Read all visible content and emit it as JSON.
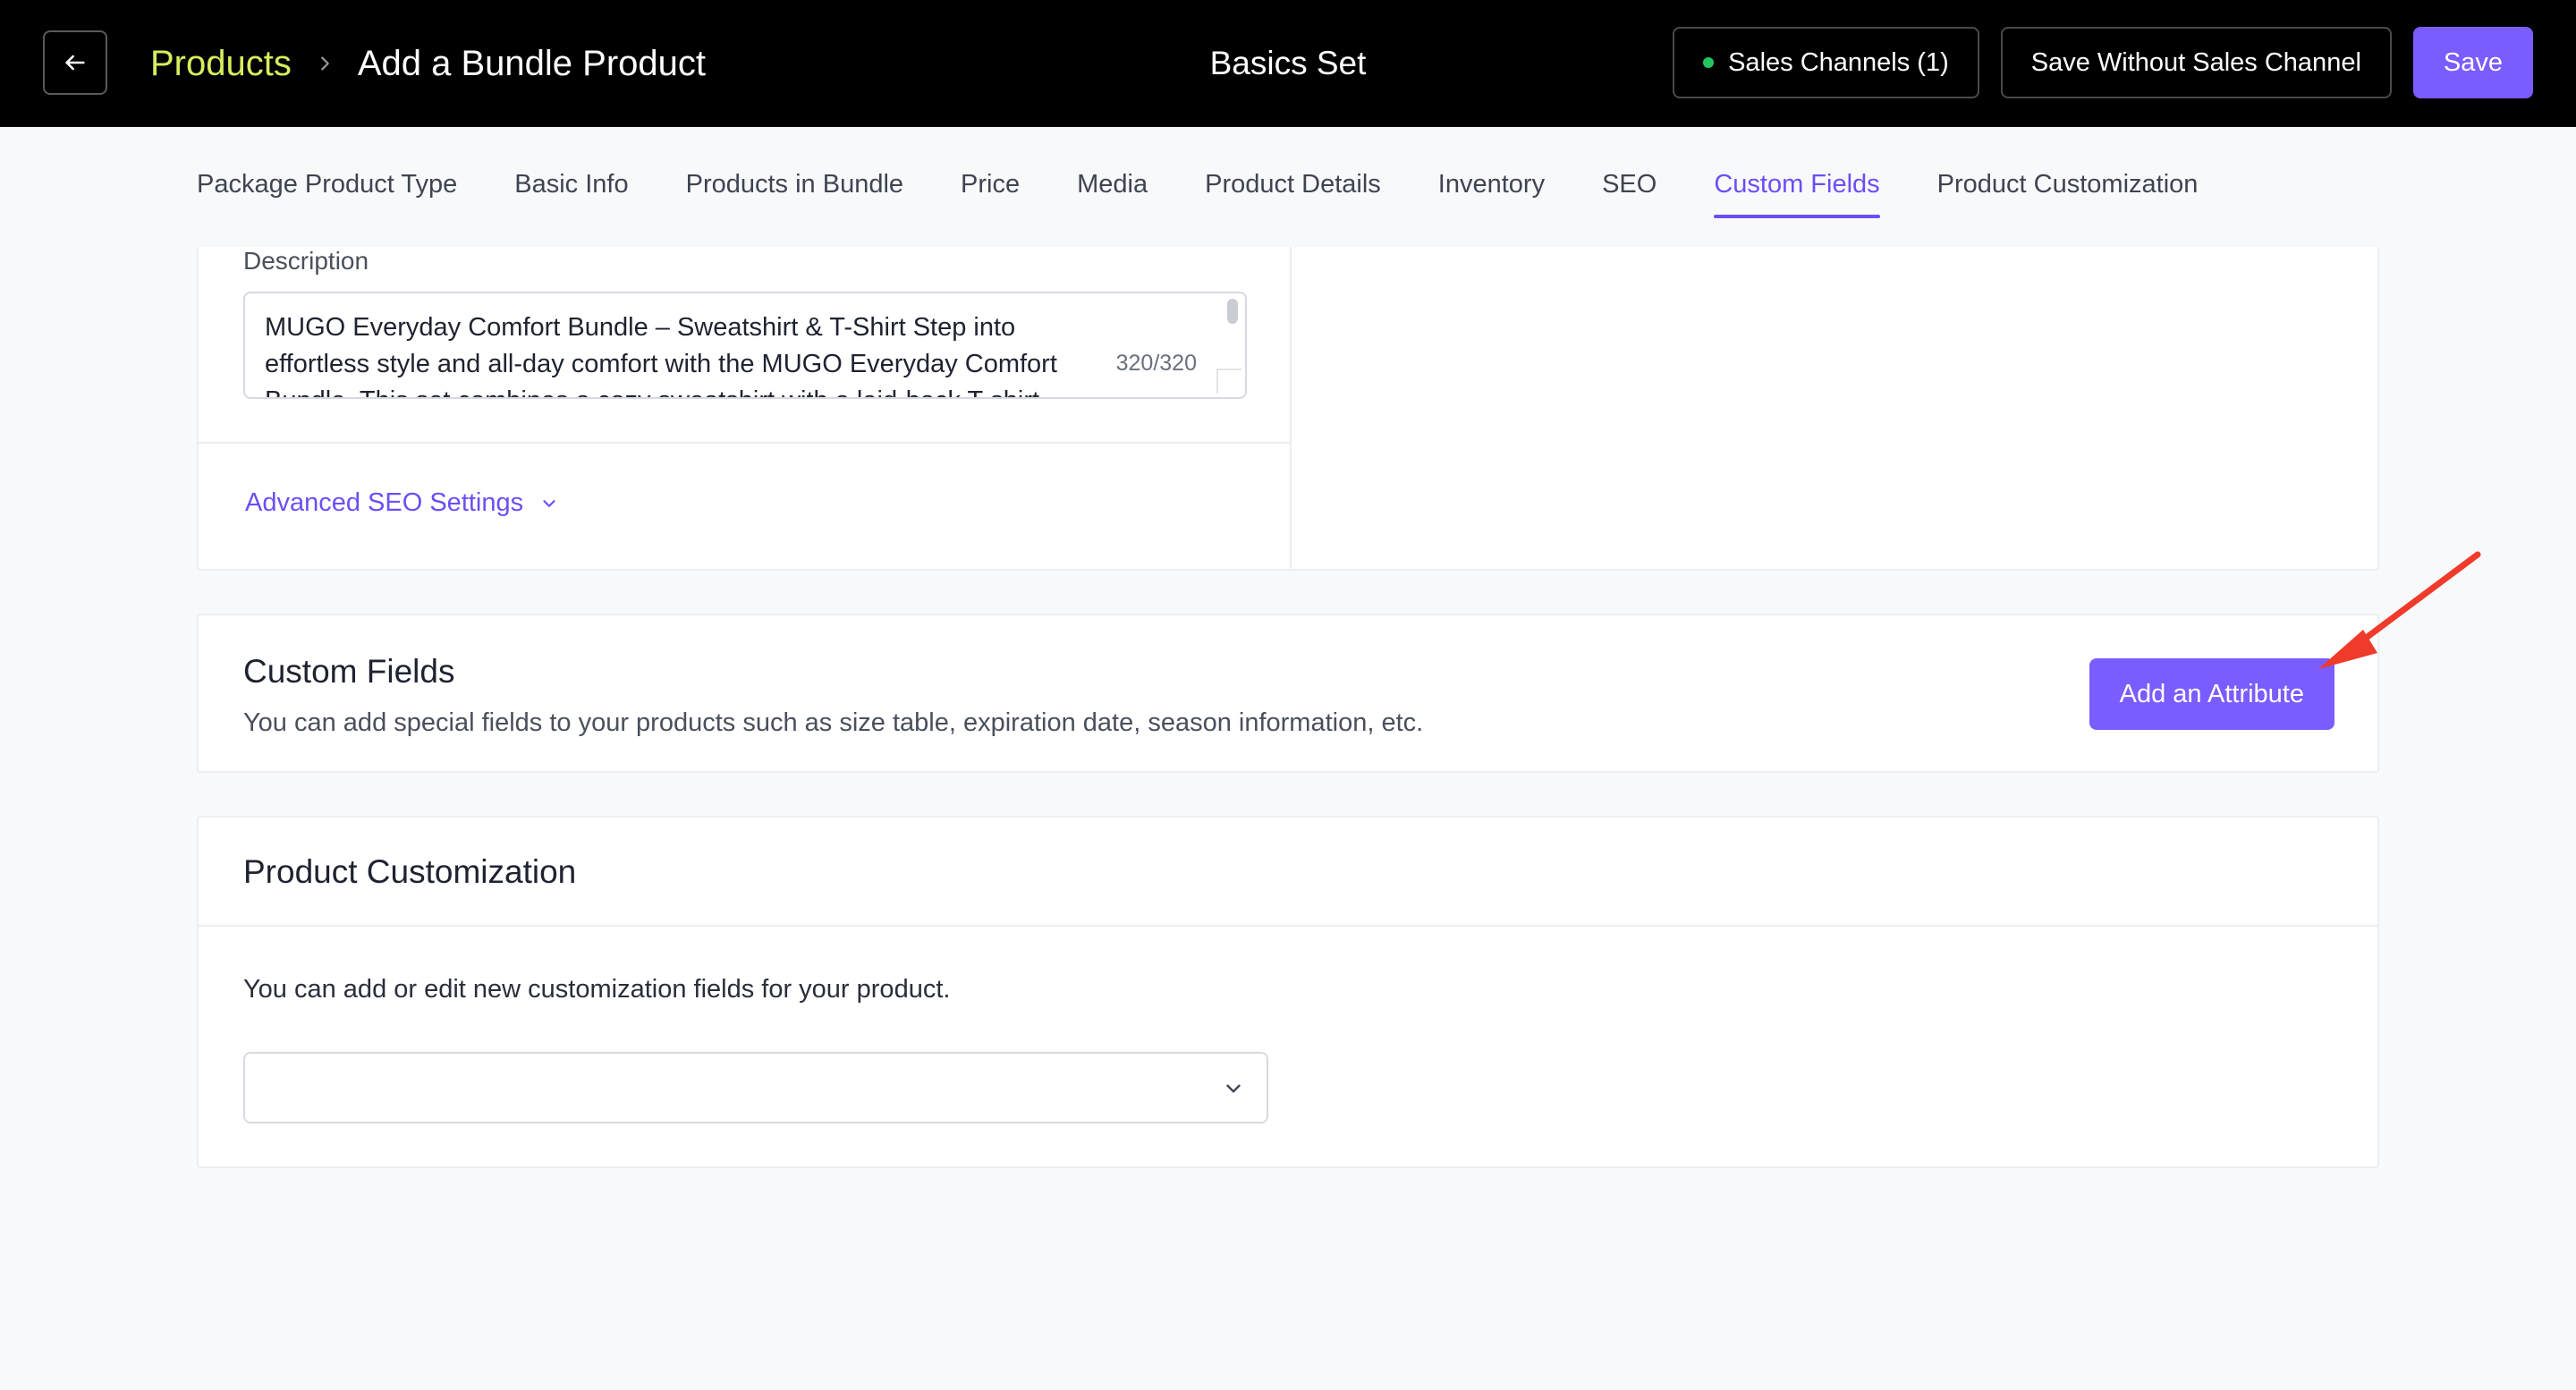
{
  "header": {
    "breadcrumb_root": "Products",
    "breadcrumb_current": "Add a Bundle Product",
    "store_name": "Basics Set",
    "sales_channels_label": "Sales Channels (1)",
    "save_without_label": "Save Without Sales Channel",
    "save_label": "Save",
    "status_color": "#22c55e"
  },
  "tabs": [
    {
      "label": "Package Product Type",
      "active": false
    },
    {
      "label": "Basic Info",
      "active": false
    },
    {
      "label": "Products in Bundle",
      "active": false
    },
    {
      "label": "Price",
      "active": false
    },
    {
      "label": "Media",
      "active": false
    },
    {
      "label": "Product Details",
      "active": false
    },
    {
      "label": "Inventory",
      "active": false
    },
    {
      "label": "SEO",
      "active": false
    },
    {
      "label": "Custom Fields",
      "active": true
    },
    {
      "label": "Product Customization",
      "active": false
    }
  ],
  "seo": {
    "description_label": "Description",
    "description_value": "MUGO Everyday Comfort Bundle – Sweatshirt & T-Shirt Step into effortless style and all-day comfort with the MUGO Everyday Comfort Bundle. This set combines a cozy sweatshirt with a laid-back T-shirt",
    "char_counter": "320/320",
    "advanced_label": "Advanced SEO Settings"
  },
  "custom_fields": {
    "title": "Custom Fields",
    "subtitle": "You can add special fields to your products such as size table, expiration date, season information, etc.",
    "add_button": "Add an Attribute"
  },
  "customization": {
    "title": "Product Customization",
    "description": "You can add or edit new customization fields for your product.",
    "select_value": ""
  },
  "colors": {
    "accent": "#7b5cff",
    "breadcrumb_link": "#d9ec5e",
    "annotation_arrow": "#f03a2a"
  }
}
